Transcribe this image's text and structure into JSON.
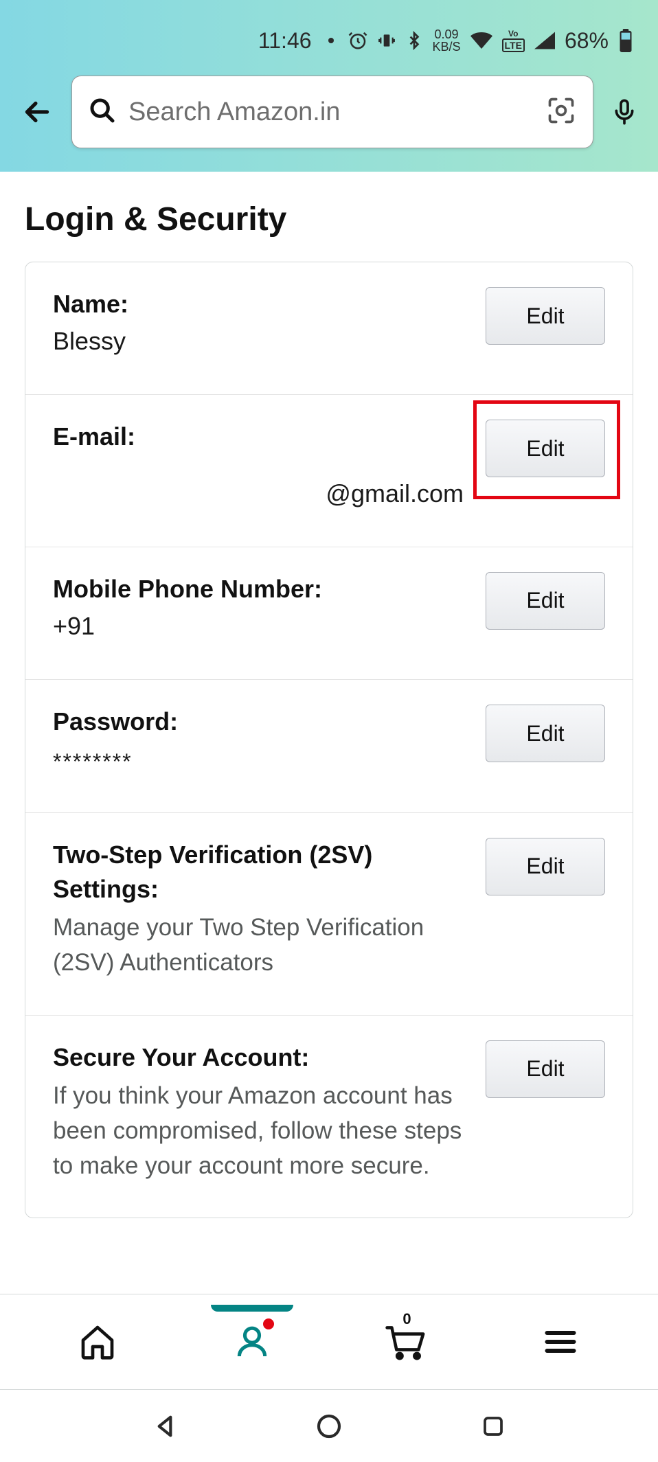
{
  "status": {
    "time": "11:46",
    "speed_top": "0.09",
    "speed_unit": "KB/S",
    "lte": "LTE",
    "vo": "Vo",
    "battery_pct": "68%"
  },
  "header": {
    "search_placeholder": "Search Amazon.in"
  },
  "page": {
    "title": "Login & Security"
  },
  "rows": {
    "name": {
      "label": "Name:",
      "value": "Blessy",
      "edit": "Edit"
    },
    "email": {
      "label": "E-mail:",
      "value": "@gmail.com",
      "edit": "Edit"
    },
    "phone": {
      "label": "Mobile Phone Number:",
      "value": "+91",
      "edit": "Edit"
    },
    "password": {
      "label": "Password:",
      "value": "********",
      "edit": "Edit"
    },
    "twosv": {
      "label": "Two-Step Verification (2SV) Settings:",
      "desc": "Manage your Two Step Verification (2SV) Authenticators",
      "edit": "Edit"
    },
    "secure": {
      "label": "Secure Your Account:",
      "desc": "If you think your Amazon account has been compromised, follow these steps to make your account more secure.",
      "edit": "Edit"
    }
  },
  "bottom_nav": {
    "cart_count": "0"
  }
}
